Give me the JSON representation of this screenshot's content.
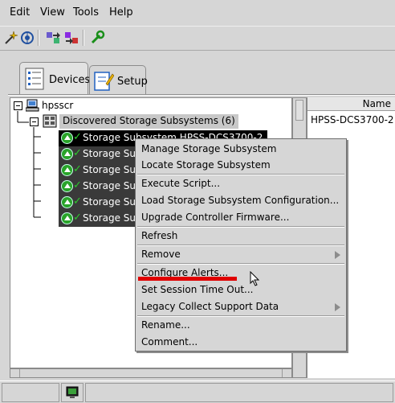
{
  "menubar": {
    "items": [
      {
        "label": "Edit"
      },
      {
        "label": "View"
      },
      {
        "label": "Tools"
      },
      {
        "label": "Help"
      }
    ]
  },
  "toolbar": {
    "icons": [
      "wand-icon",
      "network-icon",
      "arrows-left-icon",
      "arrows-right-icon",
      "wrench-icon"
    ]
  },
  "tabs": [
    {
      "label": "Devices",
      "active": true
    },
    {
      "label": "Setup",
      "active": false
    }
  ],
  "tree": {
    "root": "hpsscr",
    "group": "Discovered Storage Subsystems (6)",
    "subsystems": [
      {
        "label": "Storage Subsystem HPSS-DCS3700-2",
        "selected": true
      },
      {
        "label": "Storage Sub"
      },
      {
        "label": "Storage Sub"
      },
      {
        "label": "Storage Sub"
      },
      {
        "label": "Storage Sub"
      },
      {
        "label": "Storage Sub"
      }
    ]
  },
  "table": {
    "header": "Name",
    "rows": [
      "HPSS-DCS3700-2"
    ]
  },
  "context_menu": {
    "items": [
      {
        "label": "Manage Storage Subsystem"
      },
      {
        "label": "Locate Storage Subsystem"
      },
      {
        "label": "Execute Script..."
      },
      {
        "label": "Load Storage Subsystem Configuration..."
      },
      {
        "label": "Upgrade Controller Firmware..."
      },
      {
        "label": "Refresh"
      },
      {
        "label": "Remove",
        "submenu": true
      },
      {
        "label": "Configure Alerts..."
      },
      {
        "label": "Set Session Time Out..."
      },
      {
        "label": "Legacy Collect Support Data",
        "submenu": true
      },
      {
        "label": "Rename..."
      },
      {
        "label": "Comment..."
      }
    ]
  },
  "colors": {
    "background": "#d6d6d6",
    "selection": "#000000",
    "status_ok": "#29a329",
    "annotation": "#e00000"
  }
}
